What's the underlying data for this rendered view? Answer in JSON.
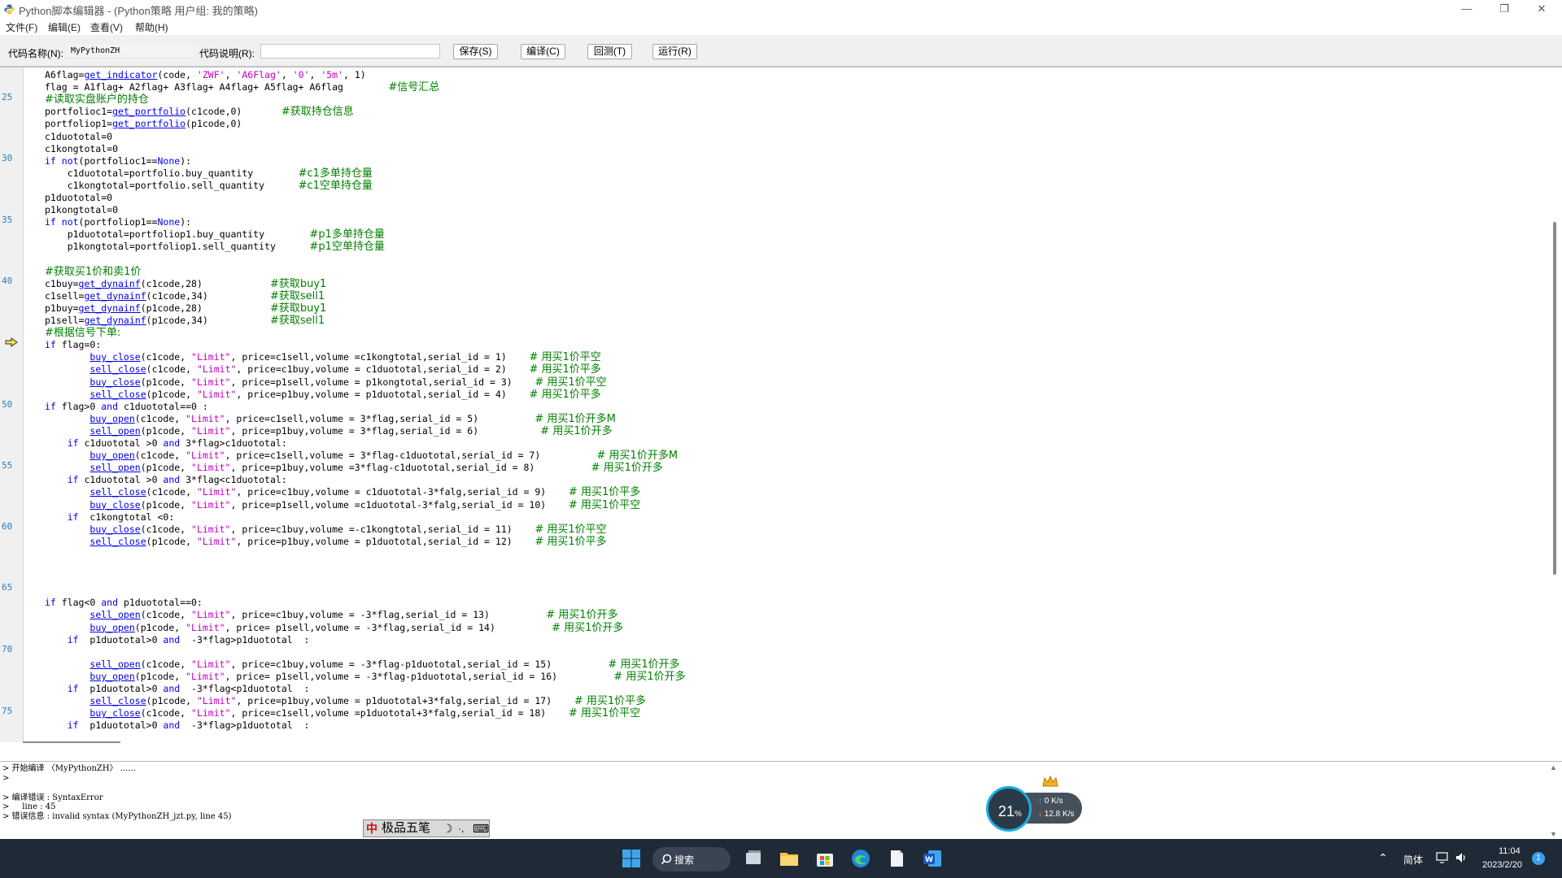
{
  "window": {
    "title": "Python脚本编辑器 - (Python策略 用户组: 我的策略)",
    "controls": {
      "minimize": "—",
      "maximize": "❐",
      "close": "✕"
    }
  },
  "menu": [
    "文件(F)",
    "编辑(E)",
    "查看(V)",
    "帮助(H)"
  ],
  "toolbar": {
    "code_name_label": "代码名称(N):",
    "code_name_value": "MyPythonZH",
    "code_desc_label": "代码说明(R):",
    "code_desc_value": "",
    "buttons": {
      "save": "保存(S)",
      "compile": "编译(C)",
      "backtest": "回测(T)",
      "run": "运行(R)"
    }
  },
  "editor": {
    "line_numbers": [
      "25",
      "30",
      "35",
      "40",
      "50",
      "55",
      "60",
      "65",
      "70",
      "75"
    ],
    "lines": [
      [
        [
          "",
          "A6flag="
        ],
        [
          "fn",
          "get_indicator"
        ],
        [
          "",
          "(code, "
        ],
        [
          "str",
          "'ZWF'"
        ],
        [
          "",
          ", "
        ],
        [
          "str",
          "'A6Flag'"
        ],
        [
          "",
          ", "
        ],
        [
          "str",
          "'0'"
        ],
        [
          "",
          ", "
        ],
        [
          "str",
          "'5m'"
        ],
        [
          "",
          ", 1)"
        ]
      ],
      [
        [
          "",
          "flag = A1flag+ A2flag+ A3flag+ A4flag+ A5flag+ A6flag        "
        ],
        [
          "cm",
          "#信号汇总"
        ]
      ],
      [
        [
          "cm",
          "#读取实盘账户的持仓"
        ]
      ],
      [
        [
          "",
          "portfolioc1="
        ],
        [
          "fn",
          "get_portfolio"
        ],
        [
          "",
          "(c1code,0)       "
        ],
        [
          "cm",
          "#获取持仓信息"
        ]
      ],
      [
        [
          "",
          "portfoliop1="
        ],
        [
          "fn",
          "get_portfolio"
        ],
        [
          "",
          "(p1code,0)"
        ]
      ],
      [
        [
          "",
          "c1duototal=0"
        ]
      ],
      [
        [
          "",
          "c1kongtotal=0"
        ]
      ],
      [
        [
          "kw",
          "if not"
        ],
        [
          "",
          "(portfolioc1=="
        ],
        [
          "kw",
          "None"
        ],
        [
          "",
          "):"
        ]
      ],
      [
        [
          "",
          "    c1duototal=portfolio.buy_quantity        "
        ],
        [
          "cm",
          "#c1多单持仓量"
        ]
      ],
      [
        [
          "",
          "    c1kongtotal=portfolio.sell_quantity      "
        ],
        [
          "cm",
          "#c1空单持仓量"
        ]
      ],
      [
        [
          "",
          "p1duototal=0"
        ]
      ],
      [
        [
          "",
          "p1kongtotal=0"
        ]
      ],
      [
        [
          "kw",
          "if not"
        ],
        [
          "",
          "(portfoliop1=="
        ],
        [
          "kw",
          "None"
        ],
        [
          "",
          "):"
        ]
      ],
      [
        [
          "",
          "    p1duototal=portfoliop1.buy_quantity        "
        ],
        [
          "cm",
          "#p1多单持仓量"
        ]
      ],
      [
        [
          "",
          "    p1kongtotal=portfoliop1.sell_quantity      "
        ],
        [
          "cm",
          "#p1空单持仓量"
        ]
      ],
      [],
      [
        [
          "cm",
          "#获取买1价和卖1价"
        ]
      ],
      [
        [
          "",
          "c1buy="
        ],
        [
          "fn",
          "get_dynainf"
        ],
        [
          "",
          "(c1code,28)            "
        ],
        [
          "cm",
          "#获取buy1"
        ]
      ],
      [
        [
          "",
          "c1sell="
        ],
        [
          "fn",
          "get_dynainf"
        ],
        [
          "",
          "(c1code,34)           "
        ],
        [
          "cm",
          "#获取sell1"
        ]
      ],
      [
        [
          "",
          "p1buy="
        ],
        [
          "fn",
          "get_dynainf"
        ],
        [
          "",
          "(p1code,28)            "
        ],
        [
          "cm",
          "#获取buy1"
        ]
      ],
      [
        [
          "",
          "p1sell="
        ],
        [
          "fn",
          "get_dynainf"
        ],
        [
          "",
          "(p1code,34)           "
        ],
        [
          "cm",
          "#获取sell1"
        ]
      ],
      [
        [
          "cm",
          "#根据信号下单:"
        ]
      ],
      [
        [
          "kw",
          "if"
        ],
        [
          "",
          " flag=0:"
        ]
      ],
      [
        [
          "",
          "        "
        ],
        [
          "fn",
          "buy_close"
        ],
        [
          "",
          "(c1code, "
        ],
        [
          "str",
          "\"Limit\""
        ],
        [
          "",
          ", price=c1sell,volume =c1kongtotal,serial_id = 1)    "
        ],
        [
          "cm",
          "# 用买1价平空"
        ]
      ],
      [
        [
          "",
          "        "
        ],
        [
          "fn",
          "sell_close"
        ],
        [
          "",
          "(c1code, "
        ],
        [
          "str",
          "\"Limit\""
        ],
        [
          "",
          ", price=c1buy,volume = c1duototal,serial_id = 2)    "
        ],
        [
          "cm",
          "# 用买1价平多"
        ]
      ],
      [
        [
          "",
          "        "
        ],
        [
          "fn",
          "buy_close"
        ],
        [
          "",
          "(p1code, "
        ],
        [
          "str",
          "\"Limit\""
        ],
        [
          "",
          ", price=p1sell,volume = p1kongtotal,serial_id = 3)    "
        ],
        [
          "cm",
          "# 用买1价平空"
        ]
      ],
      [
        [
          "",
          "        "
        ],
        [
          "fn",
          "sell_close"
        ],
        [
          "",
          "(p1code, "
        ],
        [
          "str",
          "\"Limit\""
        ],
        [
          "",
          ", price=p1buy,volume = p1duototal,serial_id = 4)    "
        ],
        [
          "cm",
          "# 用买1价平多"
        ]
      ],
      [
        [
          "kw",
          "if"
        ],
        [
          "",
          " flag>0 "
        ],
        [
          "kw",
          "and"
        ],
        [
          "",
          " c1duototal==0 :"
        ]
      ],
      [
        [
          "",
          "        "
        ],
        [
          "fn",
          "buy_open"
        ],
        [
          "",
          "(c1code, "
        ],
        [
          "str",
          "\"Limit\""
        ],
        [
          "",
          ", price=c1sell,volume = 3*flag,serial_id = 5)          "
        ],
        [
          "cm",
          "# 用买1价开多M"
        ]
      ],
      [
        [
          "",
          "        "
        ],
        [
          "fn",
          "sell_open"
        ],
        [
          "",
          "(p1code, "
        ],
        [
          "str",
          "\"Limit\""
        ],
        [
          "",
          ", price=p1buy,volume = 3*flag,serial_id = 6)           "
        ],
        [
          "cm",
          "# 用买1价开多"
        ]
      ],
      [
        [
          "",
          "    "
        ],
        [
          "kw",
          "if"
        ],
        [
          "",
          " c1duototal >0 "
        ],
        [
          "kw",
          "and"
        ],
        [
          "",
          " 3*flag>c1duototal:"
        ]
      ],
      [
        [
          "",
          "        "
        ],
        [
          "fn",
          "buy_open"
        ],
        [
          "",
          "(c1code, "
        ],
        [
          "str",
          "\"Limit\""
        ],
        [
          "",
          ", price=c1sell,volume = 3*flag-c1duototal,serial_id = 7)          "
        ],
        [
          "cm",
          "# 用买1价开多M"
        ]
      ],
      [
        [
          "",
          "        "
        ],
        [
          "fn",
          "sell_open"
        ],
        [
          "",
          "(p1code, "
        ],
        [
          "str",
          "\"Limit\""
        ],
        [
          "",
          ", price=p1buy,volume =3*flag-c1duototal,serial_id = 8)          "
        ],
        [
          "cm",
          "# 用买1价开多"
        ]
      ],
      [
        [
          "",
          "    "
        ],
        [
          "kw",
          "if"
        ],
        [
          "",
          " c1duototal >0 "
        ],
        [
          "kw",
          "and"
        ],
        [
          "",
          " 3*flag<c1duototal:"
        ]
      ],
      [
        [
          "",
          "        "
        ],
        [
          "fn",
          "sell_close"
        ],
        [
          "",
          "(c1code, "
        ],
        [
          "str",
          "\"Limit\""
        ],
        [
          "",
          ", price=c1buy,volume = c1duototal-3*falg,serial_id = 9)    "
        ],
        [
          "cm",
          "# 用买1价平多"
        ]
      ],
      [
        [
          "",
          "        "
        ],
        [
          "fn",
          "buy_close"
        ],
        [
          "",
          "(p1code, "
        ],
        [
          "str",
          "\"Limit\""
        ],
        [
          "",
          ", price=p1sell,volume =c1duototal-3*falg,serial_id = 10)    "
        ],
        [
          "cm",
          "# 用买1价平空"
        ]
      ],
      [
        [
          "",
          "    "
        ],
        [
          "kw",
          "if"
        ],
        [
          "",
          "  c1kongtotal <0:"
        ]
      ],
      [
        [
          "",
          "        "
        ],
        [
          "fn",
          "buy_close"
        ],
        [
          "",
          "(c1code, "
        ],
        [
          "str",
          "\"Limit\""
        ],
        [
          "",
          ", price=c1buy,volume =-c1kongtotal,serial_id = 11)    "
        ],
        [
          "cm",
          "# 用买1价平空"
        ]
      ],
      [
        [
          "",
          "        "
        ],
        [
          "fn",
          "sell_close"
        ],
        [
          "",
          "(p1code, "
        ],
        [
          "str",
          "\"Limit\""
        ],
        [
          "",
          ", price=p1buy,volume = p1duototal,serial_id = 12)    "
        ],
        [
          "cm",
          "# 用买1价平多"
        ]
      ],
      [],
      [],
      [],
      [],
      [
        [
          "kw",
          "if"
        ],
        [
          "",
          " flag<0 "
        ],
        [
          "kw",
          "and"
        ],
        [
          "",
          " p1duototal==0:"
        ]
      ],
      [
        [
          "",
          "        "
        ],
        [
          "fn",
          "sell_open"
        ],
        [
          "",
          "(c1code, "
        ],
        [
          "str",
          "\"Limit\""
        ],
        [
          "",
          ", price=c1buy,volume = -3*flag,serial_id = 13)          "
        ],
        [
          "cm",
          "# 用买1价开多"
        ]
      ],
      [
        [
          "",
          "        "
        ],
        [
          "fn",
          "buy_open"
        ],
        [
          "",
          "(p1code, "
        ],
        [
          "str",
          "\"Limit\""
        ],
        [
          "",
          ", price= p1sell,volume = -3*flag,serial_id = 14)          "
        ],
        [
          "cm",
          "# 用买1价开多"
        ]
      ],
      [
        [
          "",
          "    "
        ],
        [
          "kw",
          "if"
        ],
        [
          "",
          "  p1duototal>0 "
        ],
        [
          "kw",
          "and"
        ],
        [
          "",
          "  -3*flag>p1duototal  :"
        ]
      ],
      [],
      [
        [
          "",
          "        "
        ],
        [
          "fn",
          "sell_open"
        ],
        [
          "",
          "(c1code, "
        ],
        [
          "str",
          "\"Limit\""
        ],
        [
          "",
          ", price=c1buy,volume = -3*flag-p1duototal,serial_id = 15)          "
        ],
        [
          "cm",
          "# 用买1价开多"
        ]
      ],
      [
        [
          "",
          "        "
        ],
        [
          "fn",
          "buy_open"
        ],
        [
          "",
          "(p1code, "
        ],
        [
          "str",
          "\"Limit\""
        ],
        [
          "",
          ", price= p1sell,volume = -3*flag-p1duototal,serial_id = 16)          "
        ],
        [
          "cm",
          "# 用买1价开多"
        ]
      ],
      [
        [
          "",
          "    "
        ],
        [
          "kw",
          "if"
        ],
        [
          "",
          "  p1duototal>0 "
        ],
        [
          "kw",
          "and"
        ],
        [
          "",
          "  -3*flag<p1duototal  :"
        ]
      ],
      [
        [
          "",
          "        "
        ],
        [
          "fn",
          "sell_close"
        ],
        [
          "",
          "(p1code, "
        ],
        [
          "str",
          "\"Limit\""
        ],
        [
          "",
          ", price=p1buy,volume = p1duototal+3*falg,serial_id = 17)    "
        ],
        [
          "cm",
          "# 用买1价平多"
        ]
      ],
      [
        [
          "",
          "        "
        ],
        [
          "fn",
          "buy_close"
        ],
        [
          "",
          "(c1code, "
        ],
        [
          "str",
          "\"Limit\""
        ],
        [
          "",
          ", price=c1sell,volume =p1duototal+3*falg,serial_id = 18)    "
        ],
        [
          "cm",
          "# 用买1价平空"
        ]
      ],
      [
        [
          "",
          "    "
        ],
        [
          "kw",
          "if"
        ],
        [
          "",
          "  p1duototal>0 "
        ],
        [
          "kw",
          "and"
        ],
        [
          "",
          "  -3*flag>p1duototal  :"
        ]
      ]
    ]
  },
  "output": {
    "lines": [
      "> 开始编译 〈MyPythonZH〉 ......",
      ">",
      "",
      "> 编译错误 : SyntaxError",
      ">     line : 45",
      "> 错误信息 : invalid syntax (MyPythonZH_jzt.py, line 45)"
    ]
  },
  "ime": {
    "mode": "中",
    "name": "极品五笔",
    "moon": "☽",
    "punct": "·,",
    "keyboard": "⌨"
  },
  "net_widget": {
    "cpu_percent": "21",
    "percent_sign": "%",
    "upload": "0 K/s",
    "download": "12.8 K/s"
  },
  "taskbar": {
    "search_label": "搜索",
    "lang": "简体",
    "time": "11:04",
    "date": "2023/2/20",
    "notifications": "1"
  },
  "colors": {
    "keyword": "#0000ee",
    "string": "#c000c0",
    "comment": "#008000",
    "line_number": "#2b7fb8",
    "taskbar_bg": "#202a36"
  }
}
